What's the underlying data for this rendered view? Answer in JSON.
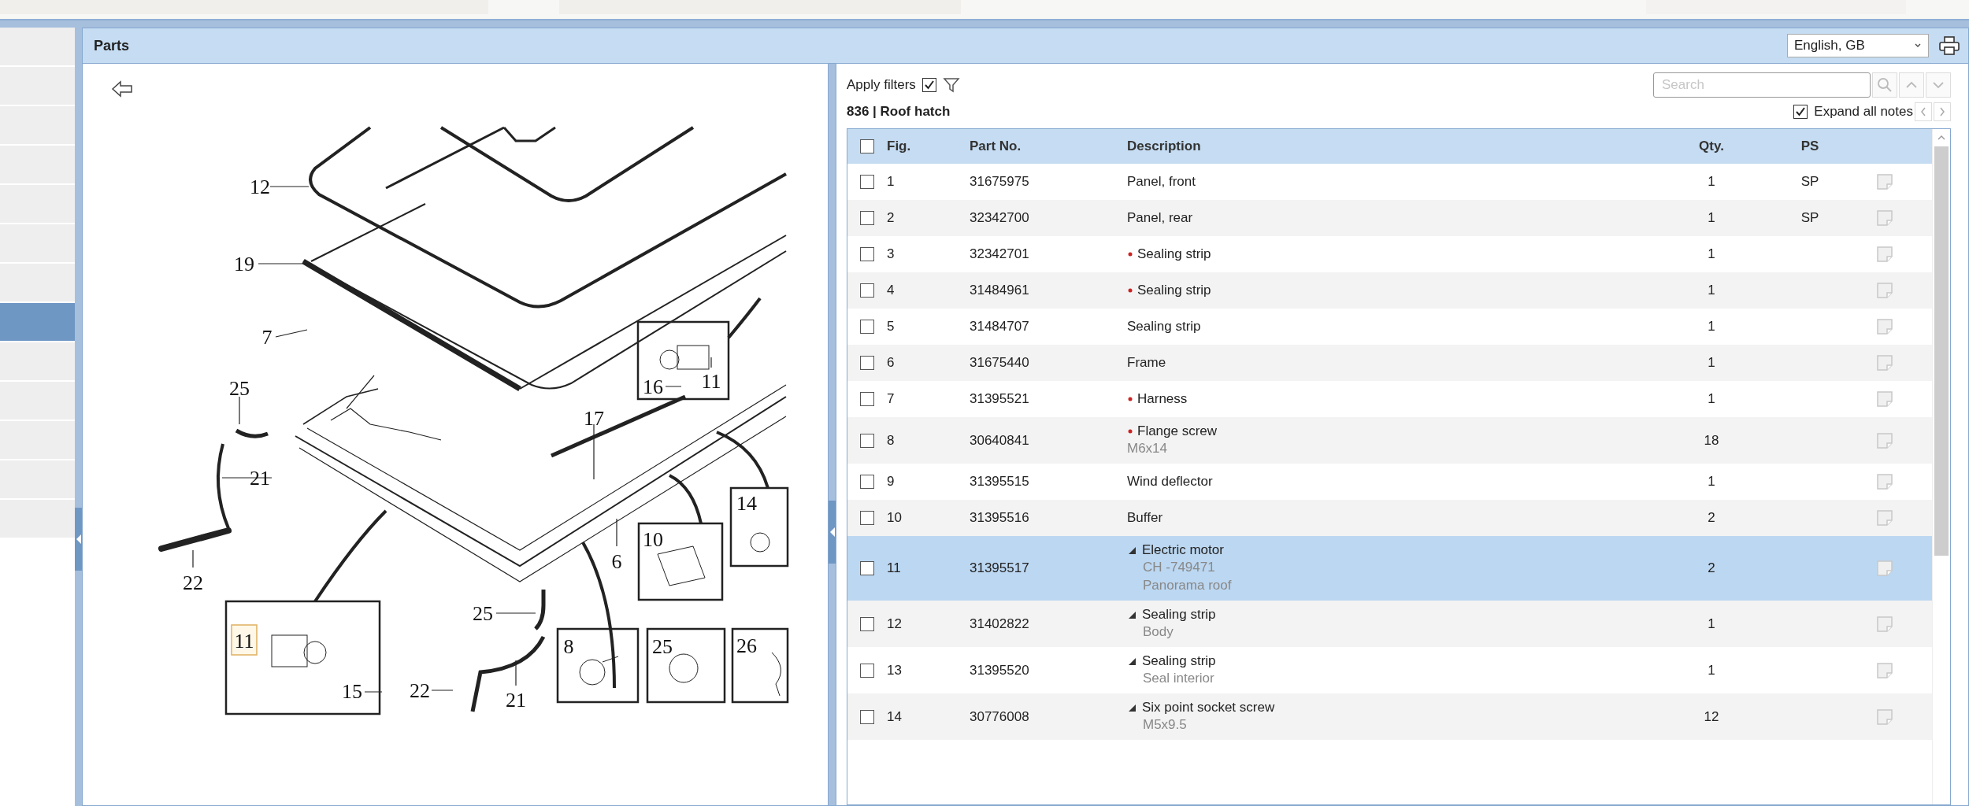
{
  "sidebar": {
    "items": [
      {
        "selected": false
      },
      {
        "selected": false
      },
      {
        "selected": false
      },
      {
        "selected": false
      },
      {
        "selected": false
      },
      {
        "selected": false
      },
      {
        "selected": false
      },
      {
        "selected": true
      },
      {
        "selected": false
      },
      {
        "selected": false
      },
      {
        "selected": false
      },
      {
        "selected": false
      },
      {
        "selected": false
      }
    ]
  },
  "panel": {
    "title": "Parts",
    "language": "English, GB"
  },
  "drawing": {
    "callouts": [
      {
        "label": "12",
        "highlighted": false
      },
      {
        "label": "19",
        "highlighted": false
      },
      {
        "label": "7",
        "highlighted": false
      },
      {
        "label": "25",
        "highlighted": false
      },
      {
        "label": "21",
        "highlighted": false
      },
      {
        "label": "22",
        "highlighted": false
      },
      {
        "label": "11",
        "highlighted": true
      },
      {
        "label": "15",
        "highlighted": false
      },
      {
        "label": "16",
        "highlighted": false
      },
      {
        "label": "11",
        "highlighted": false
      },
      {
        "label": "17",
        "highlighted": false
      },
      {
        "label": "14",
        "highlighted": false
      },
      {
        "label": "10",
        "highlighted": false
      },
      {
        "label": "6",
        "highlighted": false
      },
      {
        "label": "25",
        "highlighted": false
      },
      {
        "label": "22",
        "highlighted": false
      },
      {
        "label": "21",
        "highlighted": false
      },
      {
        "label": "8",
        "highlighted": false
      },
      {
        "label": "25",
        "highlighted": false
      },
      {
        "label": "26",
        "highlighted": false
      }
    ]
  },
  "filters": {
    "label": "Apply filters",
    "checked": true
  },
  "search": {
    "placeholder": "Search"
  },
  "heading": "836 | Roof hatch",
  "expand_notes": {
    "label": "Expand all notes",
    "checked": true
  },
  "table": {
    "select_all": {
      "checked": false
    },
    "columns": [
      "Fig.",
      "Part No.",
      "Description",
      "Qty.",
      "PS"
    ],
    "rows": [
      {
        "fig": "1",
        "part_no": "31675975",
        "description": "Panel, front",
        "marked": false,
        "expanded": false,
        "notes": [],
        "qty": "1",
        "ps": "SP",
        "checked": false,
        "selected": false
      },
      {
        "fig": "2",
        "part_no": "32342700",
        "description": "Panel, rear",
        "marked": false,
        "expanded": false,
        "notes": [],
        "qty": "1",
        "ps": "SP",
        "checked": false,
        "selected": false
      },
      {
        "fig": "3",
        "part_no": "32342701",
        "description": "Sealing strip",
        "marked": true,
        "expanded": false,
        "notes": [],
        "qty": "1",
        "checked": false,
        "selected": false
      },
      {
        "fig": "4",
        "part_no": "31484961",
        "description": "Sealing strip",
        "marked": true,
        "expanded": false,
        "notes": [],
        "qty": "1",
        "checked": false,
        "selected": false
      },
      {
        "fig": "5",
        "part_no": "31484707",
        "description": "Sealing strip",
        "marked": false,
        "expanded": false,
        "notes": [],
        "qty": "1",
        "checked": false,
        "selected": false
      },
      {
        "fig": "6",
        "part_no": "31675440",
        "description": "Frame",
        "marked": false,
        "expanded": false,
        "notes": [],
        "qty": "1",
        "checked": false,
        "selected": false
      },
      {
        "fig": "7",
        "part_no": "31395521",
        "description": "Harness",
        "marked": true,
        "expanded": false,
        "notes": [],
        "qty": "1",
        "checked": false,
        "selected": false
      },
      {
        "fig": "8",
        "part_no": "30640841",
        "description": "Flange screw",
        "marked": true,
        "expanded": false,
        "notes": [
          "M6x14"
        ],
        "qty": "18",
        "checked": false,
        "selected": false
      },
      {
        "fig": "9",
        "part_no": "31395515",
        "description": "Wind deflector",
        "marked": false,
        "expanded": false,
        "notes": [],
        "qty": "1",
        "checked": false,
        "selected": false
      },
      {
        "fig": "10",
        "part_no": "31395516",
        "description": "Buffer",
        "marked": false,
        "expanded": false,
        "notes": [],
        "qty": "2",
        "checked": false,
        "selected": false
      },
      {
        "fig": "11",
        "part_no": "31395517",
        "description": "Electric motor",
        "marked": false,
        "expanded": true,
        "notes": [
          "CH -749471",
          "Panorama roof"
        ],
        "qty": "2",
        "checked": false,
        "selected": true
      },
      {
        "fig": "12",
        "part_no": "31402822",
        "description": "Sealing strip",
        "marked": false,
        "expanded": true,
        "notes": [
          "Body"
        ],
        "qty": "1",
        "checked": false,
        "selected": false
      },
      {
        "fig": "13",
        "part_no": "31395520",
        "description": "Sealing strip",
        "marked": false,
        "expanded": true,
        "notes": [
          "Seal interior"
        ],
        "qty": "1",
        "checked": false,
        "selected": false
      },
      {
        "fig": "14",
        "part_no": "30776008",
        "description": "Six point socket screw",
        "marked": false,
        "expanded": true,
        "notes": [
          "M5x9.5"
        ],
        "qty": "12",
        "checked": false,
        "selected": false
      }
    ]
  }
}
